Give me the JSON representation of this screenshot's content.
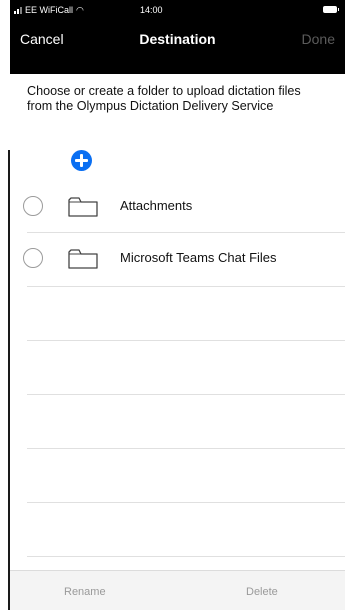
{
  "status_bar": {
    "carrier": "EE WiFiCall",
    "wifi_icon": "wifi-icon",
    "time": "14:00",
    "battery_icon": "battery-icon"
  },
  "nav": {
    "cancel_label": "Cancel",
    "title": "Destination",
    "done_label": "Done"
  },
  "description": "Choose or create a folder to upload dictation files from the Olympus Dictation Delivery Service",
  "add_button_icon": "plus-circle-icon",
  "folders": [
    {
      "label": "Attachments",
      "selected": false
    },
    {
      "label": "Microsoft Teams Chat Files",
      "selected": false
    }
  ],
  "toolbar": {
    "rename_label": "Rename",
    "delete_label": "Delete"
  },
  "colors": {
    "nav_background": "#000000",
    "accent": "#0a6ff2",
    "disabled_text": "#9a9a9a",
    "done_disabled": "#5b5b5b"
  }
}
